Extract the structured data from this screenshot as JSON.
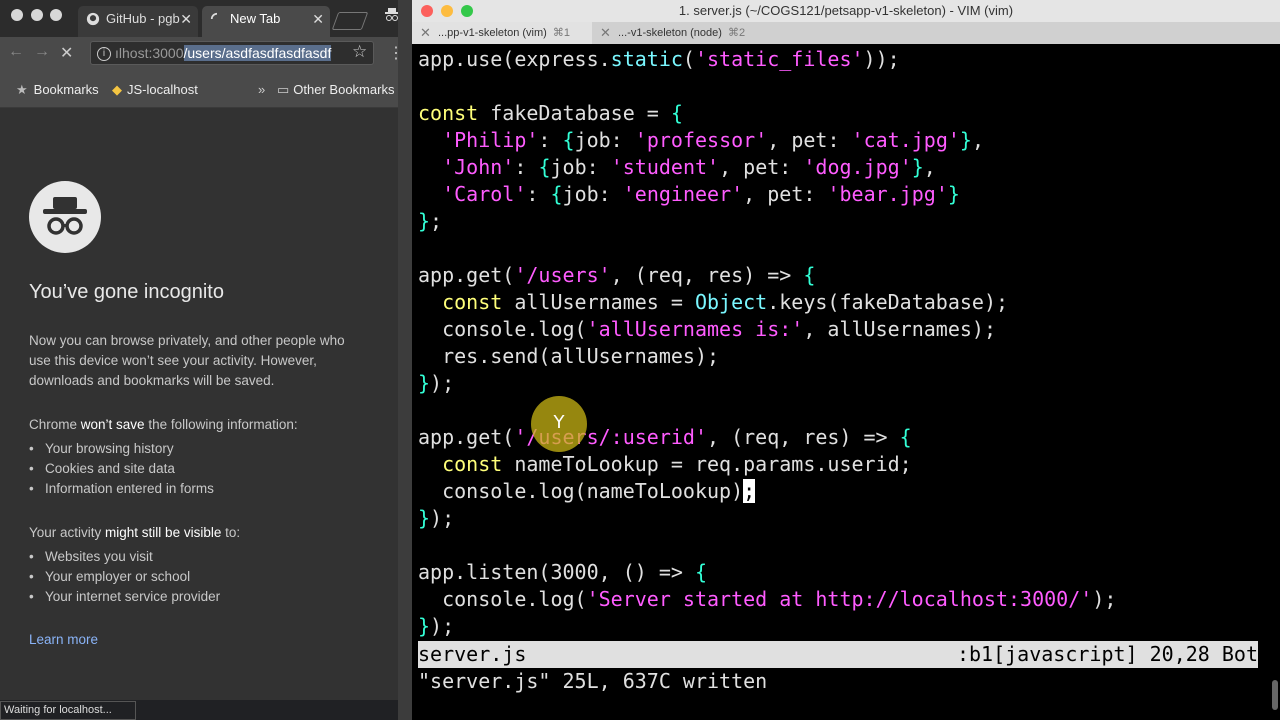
{
  "browser": {
    "tabs": [
      {
        "label": "GitHub - pgb"
      },
      {
        "label": "New Tab"
      }
    ],
    "url": {
      "host": "ılhost:3000",
      "path": "/users/asdfasdfasdfasdf"
    },
    "bookmarks": {
      "bookmarks_label": "Bookmarks",
      "js_localhost": "JS-localhost",
      "other": "Other Bookmarks",
      "overflow": "»"
    },
    "incognito": {
      "title": "You’ve gone incognito",
      "intro": "Now you can browse privately, and other people who use this device won’t see your activity. However, downloads and bookmarks will be saved.",
      "wont_save_pre": "Chrome ",
      "wont_save_bold": "won’t save",
      "wont_save_post": " the following information:",
      "wont_save_items": [
        "Your browsing history",
        "Cookies and site data",
        "Information entered in forms"
      ],
      "visible_pre": "Your activity ",
      "visible_bold": "might still be visible",
      "visible_post": " to:",
      "visible_items": [
        "Websites you visit",
        "Your employer or school",
        "Your internet service provider"
      ],
      "learn_more": "Learn more"
    },
    "status": "Waiting for localhost..."
  },
  "terminal": {
    "title": "1. server.js (~/COGS121/petsapp-v1-skeleton) - VIM (vim)",
    "tabs": [
      {
        "label": "...pp-v1-skeleton (vim)",
        "shortcut": "⌘1"
      },
      {
        "label": "...-v1-skeleton (node)",
        "shortcut": "⌘2"
      }
    ],
    "status_left": "server.js",
    "status_right": ":b1[javascript] 20,28 Bot",
    "cmdline": "\"server.js\" 25L, 637C written",
    "click_indicator": "Y"
  },
  "colors": {
    "keyword": "#ffff7a",
    "string": "#ff5cff",
    "brace": "#33ffd6",
    "function": "#7af7ff"
  }
}
